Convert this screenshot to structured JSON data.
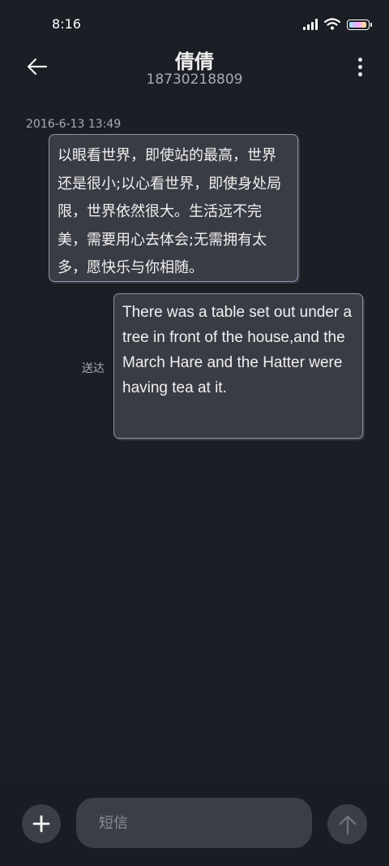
{
  "status_bar": {
    "time": "8:16",
    "icons": [
      "signal-icon",
      "wifi-icon",
      "battery-icon"
    ]
  },
  "header": {
    "contact_name": "倩倩",
    "contact_number": "18730218809",
    "icons": [
      "back-arrow-icon",
      "more-vertical-icon"
    ]
  },
  "conversation": {
    "timestamp": "2016-6-13 13:49",
    "messages": [
      {
        "direction": "incoming",
        "text": "以眼看世界，即使站的最高，世界还是很小;以心看世界，即使身处局限，世界依然很大。生活远不完美，需要用心去体会;无需拥有太多，愿快乐与你相随。"
      },
      {
        "direction": "outgoing",
        "text": "There was a table set out under a tree in front of the house,and the March Hare and the Hatter were having tea at it.",
        "status": "送达"
      }
    ]
  },
  "composer": {
    "placeholder": "短信",
    "value": "",
    "icons": [
      "plus-icon",
      "send-arrow-icon"
    ]
  },
  "colors": {
    "background": "#1c1e26",
    "bubble": "#3a3c45",
    "bubble_border": "#8d95a8",
    "secondary_text": "#a9abb3",
    "composer_control": "#3b3e47"
  }
}
